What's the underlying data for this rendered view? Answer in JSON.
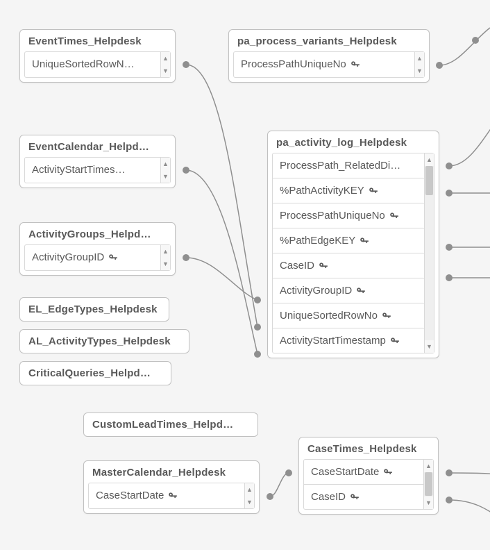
{
  "tables": {
    "event_times": {
      "title": "EventTimes_Helpdesk",
      "fields": [
        {
          "label": "UniqueSortedRowN…",
          "key": false
        }
      ]
    },
    "process_variants": {
      "title": "pa_process_variants_Helpdesk",
      "fields": [
        {
          "label": "ProcessPathUniqueNo",
          "key": true
        }
      ]
    },
    "event_calendar": {
      "title": "EventCalendar_Helpd…",
      "fields": [
        {
          "label": "ActivityStartTimes…",
          "key": false
        }
      ]
    },
    "activity_groups": {
      "title": "ActivityGroups_Helpd…",
      "fields": [
        {
          "label": "ActivityGroupID",
          "key": true
        }
      ]
    },
    "activity_log": {
      "title": "pa_activity_log_Helpdesk",
      "fields": [
        {
          "label": "ProcessPath_RelatedDi…",
          "key": false
        },
        {
          "label": "%PathActivityKEY",
          "key": true
        },
        {
          "label": "ProcessPathUniqueNo",
          "key": true
        },
        {
          "label": "%PathEdgeKEY",
          "key": true
        },
        {
          "label": "CaseID",
          "key": true
        },
        {
          "label": "ActivityGroupID",
          "key": true
        },
        {
          "label": "UniqueSortedRowNo",
          "key": true
        },
        {
          "label": "ActivityStartTimestamp",
          "key": true
        }
      ]
    },
    "case_times": {
      "title": "CaseTimes_Helpdesk",
      "fields": [
        {
          "label": "CaseStartDate",
          "key": true
        },
        {
          "label": "CaseID",
          "key": true
        }
      ]
    },
    "master_calendar": {
      "title": "MasterCalendar_Helpdesk",
      "fields": [
        {
          "label": "CaseStartDate",
          "key": true
        }
      ]
    }
  },
  "collapsed": {
    "edge_types": "EL_EdgeTypes_Helpdesk",
    "activity_types": "AL_ActivityTypes_Helpdesk",
    "critical_queries": "CriticalQueries_Helpd…",
    "custom_lead_times": "CustomLeadTimes_Helpd…"
  }
}
